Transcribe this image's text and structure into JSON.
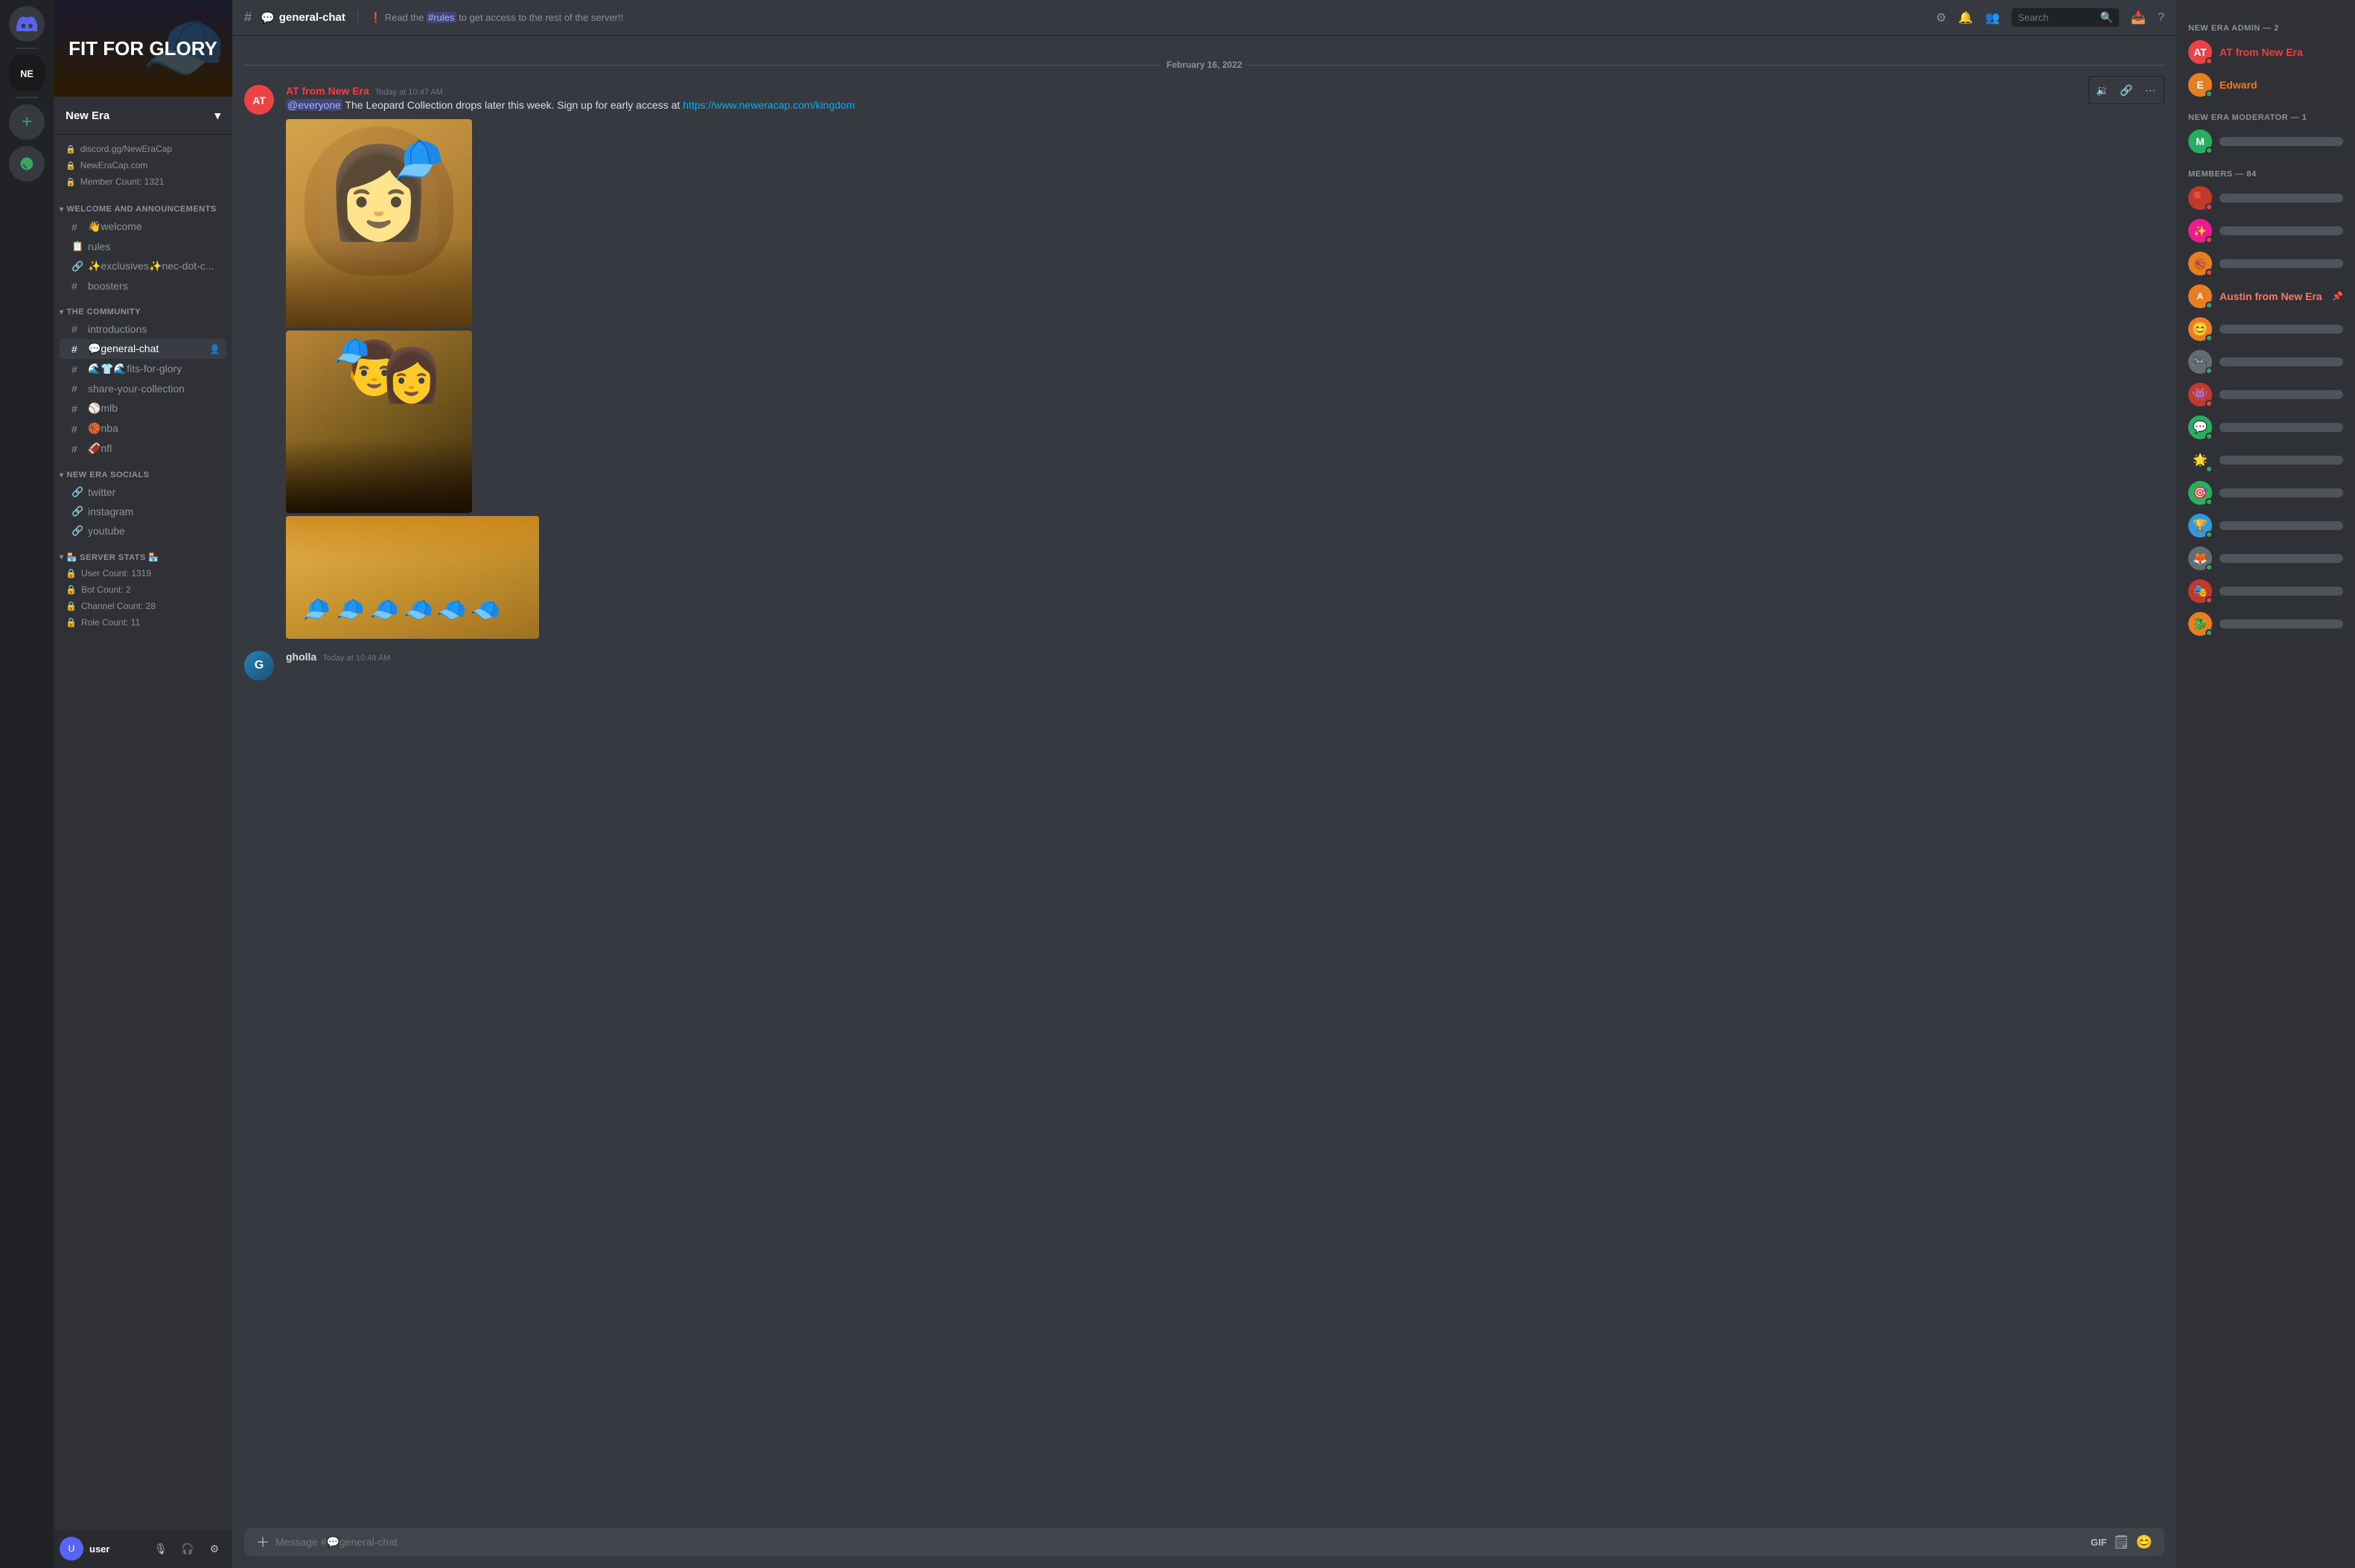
{
  "app": {
    "title": "New Era",
    "server_name": "FIT FOR GLORY"
  },
  "server_info": {
    "discord_url": "discord.gg/NewEraCap",
    "website": "NewEraCap.com",
    "member_count": "Member Count: 1321"
  },
  "categories": {
    "welcome": {
      "label": "WELCOME AND ANNOUNCEMENTS",
      "channels": [
        {
          "id": "welcome",
          "name": "👋welcome",
          "type": "text",
          "locked": false
        },
        {
          "id": "rules",
          "name": "rules",
          "type": "rules",
          "locked": false
        },
        {
          "id": "exclusives",
          "name": "✨exclusives✨nec-dot-c...",
          "type": "text",
          "locked": false
        },
        {
          "id": "boosters",
          "name": "boosters",
          "type": "text",
          "locked": false
        }
      ]
    },
    "community": {
      "label": "THE COMMUNITY",
      "channels": [
        {
          "id": "introductions",
          "name": "introductions",
          "type": "text",
          "locked": false
        },
        {
          "id": "general-chat",
          "name": "💬general-chat",
          "type": "text",
          "locked": false,
          "active": true
        },
        {
          "id": "fits-for-glory",
          "name": "🌊👕🌊fits-for-glory",
          "type": "text",
          "locked": false
        },
        {
          "id": "share-collection",
          "name": "share-your-collection",
          "type": "text",
          "locked": false
        },
        {
          "id": "mlb",
          "name": "⚾mlb",
          "type": "text",
          "locked": false
        },
        {
          "id": "nba",
          "name": "🏀nba",
          "type": "text",
          "locked": false
        },
        {
          "id": "nfl",
          "name": "🏈nfl",
          "type": "text",
          "locked": false
        }
      ]
    },
    "socials": {
      "label": "NEW ERA SOCIALS",
      "channels": [
        {
          "id": "twitter",
          "name": "twitter",
          "type": "link",
          "locked": false
        },
        {
          "id": "instagram",
          "name": "instagram",
          "type": "link",
          "locked": false
        },
        {
          "id": "youtube",
          "name": "youtube",
          "type": "link",
          "locked": false
        }
      ]
    },
    "stats": {
      "label": "🏪 SERVER STATS 🏪",
      "items": [
        {
          "label": "User Count: 1319"
        },
        {
          "label": "Bot Count: 2"
        },
        {
          "label": "Channel Count: 28"
        },
        {
          "label": "Role Count: 11"
        }
      ]
    }
  },
  "channel_header": {
    "name": "💬general-chat",
    "hash": "#",
    "description": "! Read the #rules to get access to the rest of the server!!"
  },
  "messages": {
    "date_divider": "February 16, 2022",
    "items": [
      {
        "id": "msg1",
        "author": "AT from New Era",
        "author_role": "admin",
        "timestamp": "Today at 10:47 AM",
        "avatar_initials": "AT",
        "avatar_style": "av-red",
        "content": "@everyone The Leopard Collection drops later this week. Sign up for early access at",
        "link": "https://www.neweracap.com/kingdom",
        "link_text": "https://www.neweracap.com/kingdom",
        "has_images": true
      },
      {
        "id": "msg2",
        "author": "gholla",
        "author_role": "member",
        "timestamp": "Today at 10:48 AM",
        "avatar_initials": "G",
        "avatar_style": "av-blue",
        "content": "",
        "has_images": false
      }
    ]
  },
  "chat_input": {
    "placeholder": "Message #💬general-chat"
  },
  "members_sidebar": {
    "categories": [
      {
        "label": "NEW ERA ADMIN — 2",
        "members": [
          {
            "name": "AT from New Era",
            "role": "admin",
            "avatar": "AT",
            "avatar_style": "av-red",
            "status": "dnd"
          },
          {
            "name": "Edward",
            "avatar": "E",
            "avatar_style": "av-orange",
            "status": "online"
          }
        ]
      },
      {
        "label": "NEW ERA MODERATOR — 1",
        "members": [
          {
            "name": "",
            "blurred": true,
            "avatar": "M",
            "avatar_style": "av-green",
            "status": "online"
          }
        ]
      },
      {
        "label": "MEMBERS — 84",
        "members": [
          {
            "name": "",
            "blurred": true,
            "avatar": "1",
            "avatar_style": "av-red",
            "status": "dnd"
          },
          {
            "name": "",
            "blurred": true,
            "avatar": "2",
            "avatar_style": "av-pink",
            "status": "dnd"
          },
          {
            "name": "",
            "blurred": true,
            "avatar": "3",
            "avatar_style": "av-orange",
            "status": "dnd"
          },
          {
            "name": "Austin from New Era",
            "role": "austin",
            "avatar": "A",
            "avatar_style": "av-orange",
            "status": "online",
            "has_pin": true
          },
          {
            "name": "",
            "blurred": true,
            "avatar": "5",
            "avatar_style": "av-orange",
            "status": "online"
          },
          {
            "name": "",
            "blurred": true,
            "avatar": "6",
            "avatar_style": "av-gray",
            "status": "online"
          },
          {
            "name": "",
            "blurred": true,
            "avatar": "7",
            "avatar_style": "av-red",
            "status": "dnd"
          },
          {
            "name": "",
            "blurred": true,
            "avatar": "8",
            "avatar_style": "av-green",
            "status": "online"
          },
          {
            "name": "",
            "blurred": true,
            "avatar": "9",
            "avatar_style": "av-dark",
            "status": "online"
          },
          {
            "name": "",
            "blurred": true,
            "avatar": "10",
            "avatar_style": "av-green",
            "status": "online"
          },
          {
            "name": "",
            "blurred": true,
            "avatar": "11",
            "avatar_style": "av-blue",
            "status": "online"
          },
          {
            "name": "",
            "blurred": true,
            "avatar": "12",
            "avatar_style": "av-gray",
            "status": "online"
          },
          {
            "name": "",
            "blurred": true,
            "avatar": "13",
            "avatar_style": "av-red",
            "status": "dnd"
          },
          {
            "name": "",
            "blurred": true,
            "avatar": "14",
            "avatar_style": "av-orange",
            "status": "online"
          }
        ]
      }
    ]
  },
  "icons": {
    "hash": "#",
    "lock": "🔒",
    "link": "🔗",
    "rules": "📋",
    "chevron_down": "▾",
    "search": "🔍",
    "bell": "🔔",
    "pin": "📌",
    "members": "👥",
    "question": "?",
    "mic": "🎙",
    "headphone": "🎧",
    "settings": "⚙"
  },
  "search": {
    "placeholder": "Search"
  }
}
